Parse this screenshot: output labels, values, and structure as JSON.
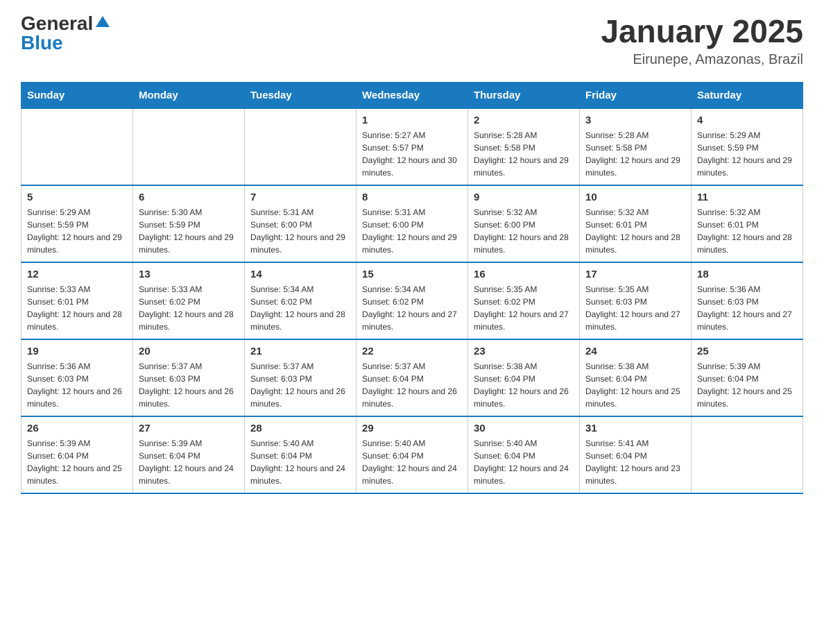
{
  "logo": {
    "general": "General",
    "blue": "Blue"
  },
  "header": {
    "title": "January 2025",
    "subtitle": "Eirunepe, Amazonas, Brazil"
  },
  "days_of_week": [
    "Sunday",
    "Monday",
    "Tuesday",
    "Wednesday",
    "Thursday",
    "Friday",
    "Saturday"
  ],
  "weeks": [
    [
      {
        "day": "",
        "info": ""
      },
      {
        "day": "",
        "info": ""
      },
      {
        "day": "",
        "info": ""
      },
      {
        "day": "1",
        "info": "Sunrise: 5:27 AM\nSunset: 5:57 PM\nDaylight: 12 hours and 30 minutes."
      },
      {
        "day": "2",
        "info": "Sunrise: 5:28 AM\nSunset: 5:58 PM\nDaylight: 12 hours and 29 minutes."
      },
      {
        "day": "3",
        "info": "Sunrise: 5:28 AM\nSunset: 5:58 PM\nDaylight: 12 hours and 29 minutes."
      },
      {
        "day": "4",
        "info": "Sunrise: 5:29 AM\nSunset: 5:59 PM\nDaylight: 12 hours and 29 minutes."
      }
    ],
    [
      {
        "day": "5",
        "info": "Sunrise: 5:29 AM\nSunset: 5:59 PM\nDaylight: 12 hours and 29 minutes."
      },
      {
        "day": "6",
        "info": "Sunrise: 5:30 AM\nSunset: 5:59 PM\nDaylight: 12 hours and 29 minutes."
      },
      {
        "day": "7",
        "info": "Sunrise: 5:31 AM\nSunset: 6:00 PM\nDaylight: 12 hours and 29 minutes."
      },
      {
        "day": "8",
        "info": "Sunrise: 5:31 AM\nSunset: 6:00 PM\nDaylight: 12 hours and 29 minutes."
      },
      {
        "day": "9",
        "info": "Sunrise: 5:32 AM\nSunset: 6:00 PM\nDaylight: 12 hours and 28 minutes."
      },
      {
        "day": "10",
        "info": "Sunrise: 5:32 AM\nSunset: 6:01 PM\nDaylight: 12 hours and 28 minutes."
      },
      {
        "day": "11",
        "info": "Sunrise: 5:32 AM\nSunset: 6:01 PM\nDaylight: 12 hours and 28 minutes."
      }
    ],
    [
      {
        "day": "12",
        "info": "Sunrise: 5:33 AM\nSunset: 6:01 PM\nDaylight: 12 hours and 28 minutes."
      },
      {
        "day": "13",
        "info": "Sunrise: 5:33 AM\nSunset: 6:02 PM\nDaylight: 12 hours and 28 minutes."
      },
      {
        "day": "14",
        "info": "Sunrise: 5:34 AM\nSunset: 6:02 PM\nDaylight: 12 hours and 28 minutes."
      },
      {
        "day": "15",
        "info": "Sunrise: 5:34 AM\nSunset: 6:02 PM\nDaylight: 12 hours and 27 minutes."
      },
      {
        "day": "16",
        "info": "Sunrise: 5:35 AM\nSunset: 6:02 PM\nDaylight: 12 hours and 27 minutes."
      },
      {
        "day": "17",
        "info": "Sunrise: 5:35 AM\nSunset: 6:03 PM\nDaylight: 12 hours and 27 minutes."
      },
      {
        "day": "18",
        "info": "Sunrise: 5:36 AM\nSunset: 6:03 PM\nDaylight: 12 hours and 27 minutes."
      }
    ],
    [
      {
        "day": "19",
        "info": "Sunrise: 5:36 AM\nSunset: 6:03 PM\nDaylight: 12 hours and 26 minutes."
      },
      {
        "day": "20",
        "info": "Sunrise: 5:37 AM\nSunset: 6:03 PM\nDaylight: 12 hours and 26 minutes."
      },
      {
        "day": "21",
        "info": "Sunrise: 5:37 AM\nSunset: 6:03 PM\nDaylight: 12 hours and 26 minutes."
      },
      {
        "day": "22",
        "info": "Sunrise: 5:37 AM\nSunset: 6:04 PM\nDaylight: 12 hours and 26 minutes."
      },
      {
        "day": "23",
        "info": "Sunrise: 5:38 AM\nSunset: 6:04 PM\nDaylight: 12 hours and 26 minutes."
      },
      {
        "day": "24",
        "info": "Sunrise: 5:38 AM\nSunset: 6:04 PM\nDaylight: 12 hours and 25 minutes."
      },
      {
        "day": "25",
        "info": "Sunrise: 5:39 AM\nSunset: 6:04 PM\nDaylight: 12 hours and 25 minutes."
      }
    ],
    [
      {
        "day": "26",
        "info": "Sunrise: 5:39 AM\nSunset: 6:04 PM\nDaylight: 12 hours and 25 minutes."
      },
      {
        "day": "27",
        "info": "Sunrise: 5:39 AM\nSunset: 6:04 PM\nDaylight: 12 hours and 24 minutes."
      },
      {
        "day": "28",
        "info": "Sunrise: 5:40 AM\nSunset: 6:04 PM\nDaylight: 12 hours and 24 minutes."
      },
      {
        "day": "29",
        "info": "Sunrise: 5:40 AM\nSunset: 6:04 PM\nDaylight: 12 hours and 24 minutes."
      },
      {
        "day": "30",
        "info": "Sunrise: 5:40 AM\nSunset: 6:04 PM\nDaylight: 12 hours and 24 minutes."
      },
      {
        "day": "31",
        "info": "Sunrise: 5:41 AM\nSunset: 6:04 PM\nDaylight: 12 hours and 23 minutes."
      },
      {
        "day": "",
        "info": ""
      }
    ]
  ]
}
